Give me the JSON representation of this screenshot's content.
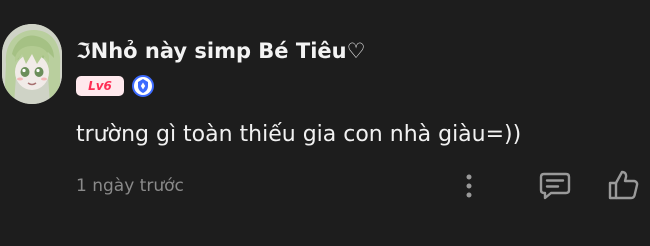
{
  "comment": {
    "username": "ℑNhỏ này simp Bé Tiêu♡",
    "level_label": "Lv6",
    "text": "trường gì toàn thiếu gia con nhà giàu=))",
    "timestamp": "1 ngày trước"
  },
  "icons": {
    "avatar": "anime-girl-avatar",
    "verified": "verified-shield-icon",
    "more": "more-vertical-icon",
    "reply": "reply-comment-icon",
    "like": "thumbs-up-icon"
  },
  "colors": {
    "background": "#1d1d1d",
    "text_primary": "#f1f1f1",
    "text_secondary": "#8a8a8a",
    "level_badge_bg": "#ffe9ed",
    "level_badge_text": "#ff2d55",
    "verified_blue": "#3d6bff",
    "icon_gray": "#9a9a9a"
  }
}
